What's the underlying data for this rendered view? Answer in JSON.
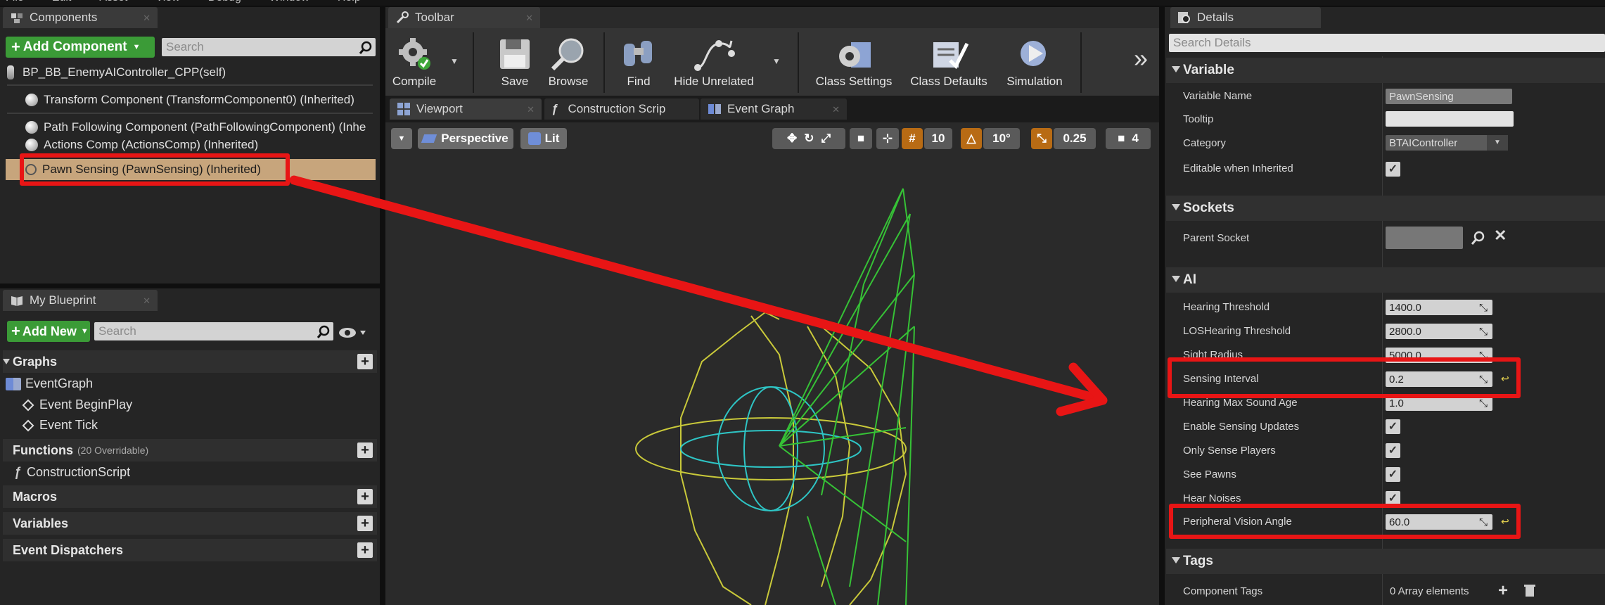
{
  "menu": [
    "File",
    "Edit",
    "Asset",
    "View",
    "Debug",
    "Window",
    "Help"
  ],
  "components": {
    "tab": "Components",
    "add_button": "Add Component",
    "search_placeholder": "Search",
    "items": [
      "BP_BB_EnemyAIController_CPP(self)",
      "Transform Component (TransformComponent0) (Inherited)",
      "Path Following Component (PathFollowingComponent) (Inhe",
      "Actions Comp (ActionsComp) (Inherited)",
      "Pawn Sensing (PawnSensing) (Inherited)"
    ]
  },
  "blueprint": {
    "tab": "My Blueprint",
    "add_new": "Add New",
    "search_placeholder": "Search",
    "graphs": "Graphs",
    "event_graph": "EventGraph",
    "event_begin_play": "Event BeginPlay",
    "event_tick": "Event Tick",
    "functions": "Functions",
    "functions_note": "(20 Overridable)",
    "construction_script": "ConstructionScript",
    "macros": "Macros",
    "variables": "Variables",
    "event_dispatchers": "Event Dispatchers"
  },
  "toolbar": {
    "tab": "Toolbar",
    "compile": "Compile",
    "save": "Save",
    "browse": "Browse",
    "find": "Find",
    "hide_unrelated": "Hide Unrelated",
    "class_settings": "Class Settings",
    "class_defaults": "Class Defaults",
    "simulation": "Simulation",
    "overflow": "»"
  },
  "editor_tabs": {
    "viewport": "Viewport",
    "construction": "Construction Scrip",
    "event_graph": "Event Graph"
  },
  "viewport": {
    "perspective": "Perspective",
    "lit": "Lit",
    "grid_snap": "10",
    "rotation_snap": "10°",
    "scale_snap": "0.25",
    "camera_speed": "4"
  },
  "details": {
    "tab": "Details",
    "search_placeholder": "Search Details",
    "variable": {
      "header": "Variable",
      "name_label": "Variable Name",
      "name_value": "PawnSensing",
      "tooltip_label": "Tooltip",
      "tooltip_value": "",
      "category_label": "Category",
      "category_value": "BTAIController",
      "editable_label": "Editable when Inherited"
    },
    "sockets": {
      "header": "Sockets",
      "parent_label": "Parent Socket"
    },
    "ai": {
      "header": "AI",
      "hearing_threshold_label": "Hearing Threshold",
      "hearing_threshold_value": "1400.0",
      "los_label": "LOSHearing Threshold",
      "los_value": "2800.0",
      "sight_label": "Sight Radius",
      "sight_value": "5000.0",
      "sensing_interval_label": "Sensing Interval",
      "sensing_interval_value": "0.2",
      "hearing_age_label": "Hearing Max Sound Age",
      "hearing_age_value": "1.0",
      "enable_updates_label": "Enable Sensing Updates",
      "only_players_label": "Only Sense Players",
      "see_pawns_label": "See Pawns",
      "hear_noises_label": "Hear Noises",
      "peripheral_label": "Peripheral Vision Angle",
      "peripheral_value": "60.0"
    },
    "tags": {
      "header": "Tags",
      "component_tags_label": "Component Tags",
      "component_tags_value": "0 Array elements"
    }
  },
  "colors": {
    "highlight": "#e81515",
    "selected_row": "#c7a57c",
    "green_button": "#3b9b37",
    "orange_toggle": "#b86b14"
  }
}
